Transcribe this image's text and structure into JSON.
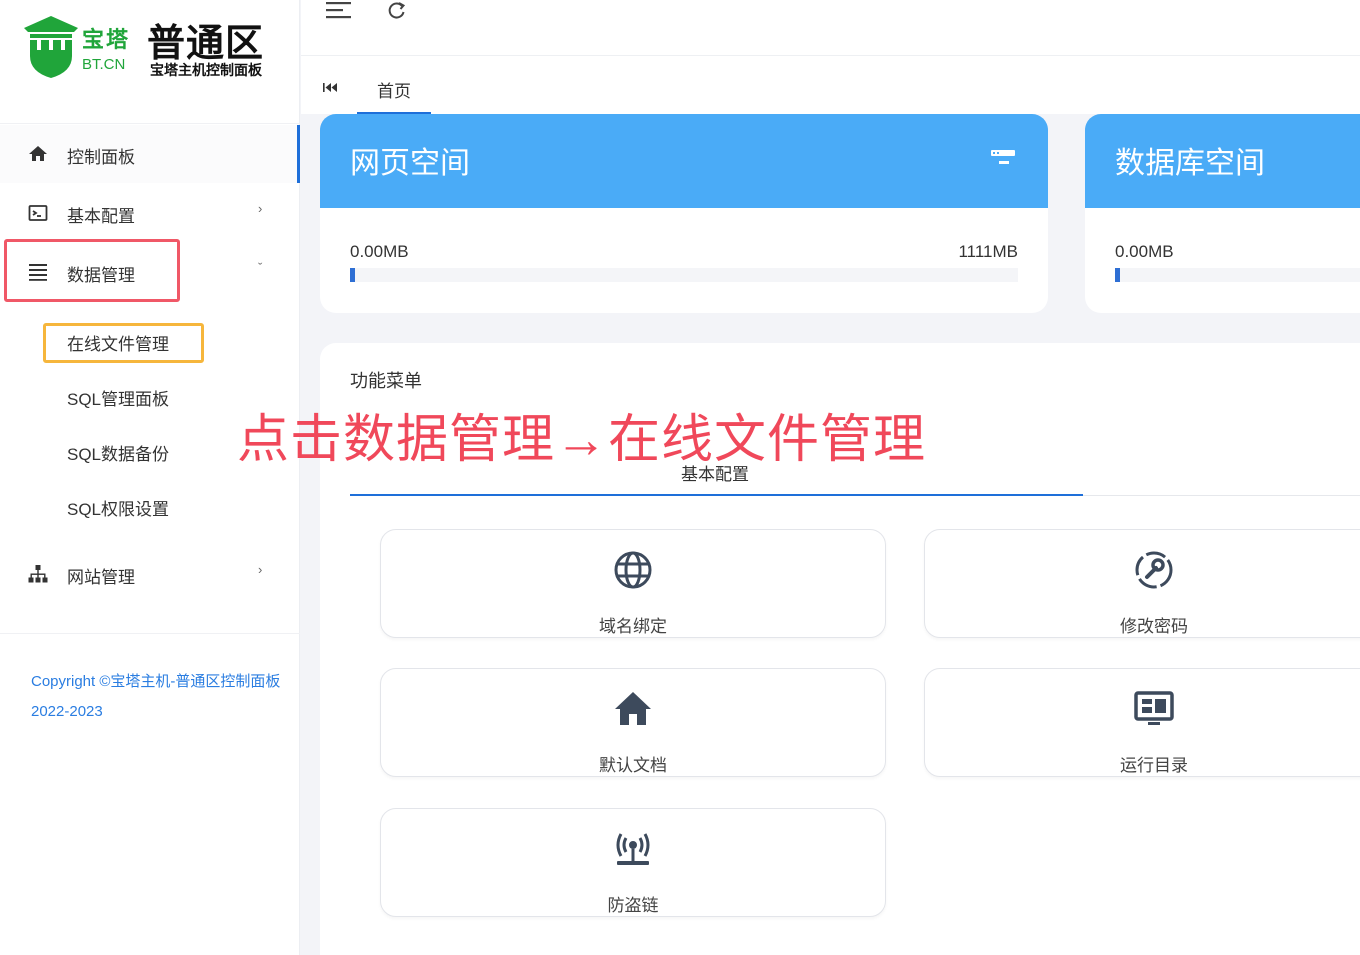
{
  "logo": {
    "brand_cn": "宝塔",
    "brand_en": "BT.CN",
    "title": "普通区",
    "subtitle": "宝塔主机控制面板"
  },
  "sidebar": {
    "items": [
      {
        "label": "控制面板",
        "icon": "home-icon"
      },
      {
        "label": "基本配置",
        "icon": "terminal-icon"
      },
      {
        "label": "数据管理",
        "icon": "list-icon"
      },
      {
        "label": "网站管理",
        "icon": "sitemap-icon"
      }
    ],
    "data_sub": [
      {
        "label": "在线文件管理"
      },
      {
        "label": "SQL管理面板"
      },
      {
        "label": "SQL数据备份"
      },
      {
        "label": "SQL权限设置"
      }
    ],
    "copyright": "Copyright ©宝塔主机-普通区控制面板 2022-2023"
  },
  "tabs": {
    "home": "首页"
  },
  "cards": {
    "web": {
      "title": "网页空间",
      "used": "0.00MB",
      "total": "1111MB",
      "progress": 0.0
    },
    "db": {
      "title": "数据库空间",
      "used": "0.00MB",
      "progress": 0.0
    }
  },
  "panel": {
    "title": "功能菜单",
    "tab": "基本配置",
    "buttons": [
      {
        "label": "域名绑定",
        "icon": "globe-icon"
      },
      {
        "label": "修改密码",
        "icon": "key-settings-icon"
      },
      {
        "label": "默认文档",
        "icon": "home-icon"
      },
      {
        "label": "运行目录",
        "icon": "dashboard-icon"
      },
      {
        "label": "防盗链",
        "icon": "broadcast-icon"
      }
    ]
  },
  "annotation": "点击数据管理→在线文件管理",
  "colors": {
    "accent": "#1e6fd9",
    "card_header": "#4aabf7",
    "brand_green": "#20a53a",
    "annotation_red": "#f0485a",
    "highlight_orange": "#f6b63c"
  }
}
